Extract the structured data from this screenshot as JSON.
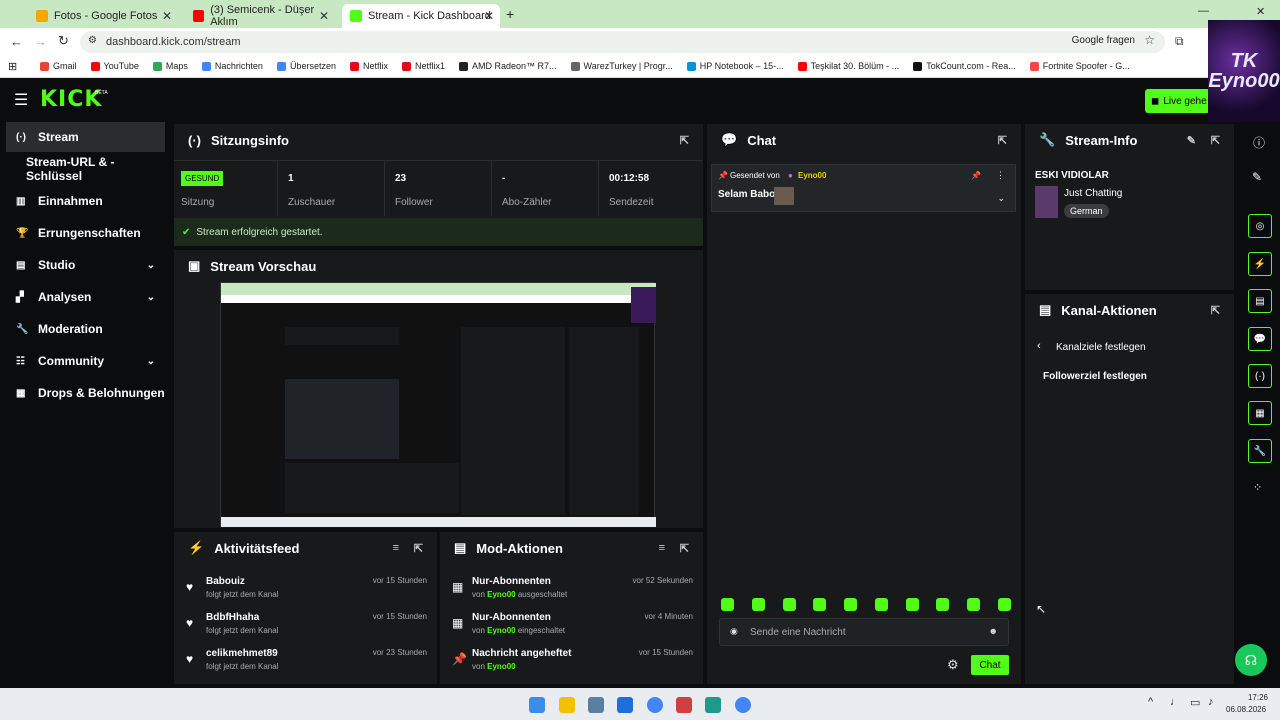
{
  "browser": {
    "tabs": [
      {
        "label": "Fotos - Google Fotos",
        "color": "#f2a900"
      },
      {
        "label": "(3) Semicenk - Düşer Aklım",
        "color": "#ff0000"
      },
      {
        "label": "Stream - Kick Dashboard",
        "color": "#53fc18"
      }
    ],
    "url": "dashboard.kick.com/stream",
    "google_ask": "Google fragen",
    "bookmarks": [
      {
        "label": "Gmail",
        "color": "#ea4335"
      },
      {
        "label": "YouTube",
        "color": "#ff0000"
      },
      {
        "label": "Maps",
        "color": "#34a853"
      },
      {
        "label": "Nachrichten",
        "color": "#4285f4"
      },
      {
        "label": "Übersetzen",
        "color": "#4285f4"
      },
      {
        "label": "Netflix",
        "color": "#e50914"
      },
      {
        "label": "Netflix1",
        "color": "#e50914"
      },
      {
        "label": "AMD Radeon™ R7...",
        "color": "#222222"
      },
      {
        "label": "WarezTurkey | Progr...",
        "color": "#666666"
      },
      {
        "label": "HP Notebook – 15-...",
        "color": "#0096d6"
      },
      {
        "label": "Teşkilat 30. Bölüm - ...",
        "color": "#ff0000"
      },
      {
        "label": "TokCount.com - Rea...",
        "color": "#111111"
      },
      {
        "label": "Fortnite Spoofer - G...",
        "color": "#ff4444"
      }
    ]
  },
  "kick": {
    "logo": "KICK",
    "beta": "BETA",
    "live_button": "Live gehe",
    "avatar_text": "TK Eyno00",
    "sidebar": [
      {
        "label": "Stream",
        "icon": "broadcast-icon",
        "active": true
      },
      {
        "label": "Stream-URL & -Schlüssel",
        "icon": "",
        "sub": true
      },
      {
        "label": "Einnahmen",
        "icon": "chart-icon"
      },
      {
        "label": "Errungenschaften",
        "icon": "trophy-icon"
      },
      {
        "label": "Studio",
        "icon": "studio-icon",
        "chevron": true
      },
      {
        "label": "Analysen",
        "icon": "analytics-icon",
        "chevron": true
      },
      {
        "label": "Moderation",
        "icon": "wrench-icon"
      },
      {
        "label": "Community",
        "icon": "community-icon",
        "chevron": true
      },
      {
        "label": "Drops & Belohnungen",
        "icon": "gift-icon"
      }
    ],
    "session": {
      "title": "Sitzungsinfo",
      "status_badge": "GESUND",
      "stats": [
        {
          "value": "",
          "label": "Sitzung"
        },
        {
          "value": "1",
          "label": "Zuschauer"
        },
        {
          "value": "23",
          "label": "Follower"
        },
        {
          "value": "-",
          "label": "Abo-Zähler"
        },
        {
          "value": "00:12:58",
          "label": "Sendezeit"
        }
      ],
      "success_msg": "Stream erfolgreich gestartet."
    },
    "preview": {
      "title": "Stream Vorschau"
    },
    "activity": {
      "title": "Aktivitätsfeed",
      "items": [
        {
          "name": "Babouiz",
          "sub": "folgt jetzt dem Kanal",
          "time": "vor 15 Stunden"
        },
        {
          "name": "BdbfHhaha",
          "sub": "folgt jetzt dem Kanal",
          "time": "vor 15 Stunden"
        },
        {
          "name": "celikmehmet89",
          "sub": "folgt jetzt dem Kanal",
          "time": "vor 23 Stunden"
        }
      ]
    },
    "modactions": {
      "title": "Mod-Aktionen",
      "items": [
        {
          "name": "Nur-Abonnenten",
          "by": "von",
          "user": "Eyno00",
          "action": "ausgeschaltet",
          "time": "vor 52 Sekunden",
          "icon": "gift-icon"
        },
        {
          "name": "Nur-Abonnenten",
          "by": "von",
          "user": "Eyno00",
          "action": "eingeschaltet",
          "time": "vor 4 Minuten",
          "icon": "gift-icon"
        },
        {
          "name": "Nachricht angeheftet",
          "by": "von",
          "user": "Eyno00",
          "action": "",
          "time": "vor 15 Stunden",
          "icon": "pin-icon"
        }
      ]
    },
    "chat": {
      "title": "Chat",
      "pinned_label": "Gesendet von",
      "pinned_user": "Eyno00",
      "pinned_message": "Selam Babo",
      "input_placeholder": "Sende eine Nachricht",
      "send_label": "Chat"
    },
    "streaminfo": {
      "title": "Stream-Info",
      "stream_title": "ESKI VIDIOLAR",
      "category": "Just Chatting",
      "language": "German"
    },
    "channel_actions": {
      "title": "Kanal-Aktionen",
      "back_label": "Kanalziele festlegen",
      "item": "Followerziel festlegen"
    }
  },
  "taskbar": {
    "time": "17:26",
    "date": "06.08.2026"
  }
}
